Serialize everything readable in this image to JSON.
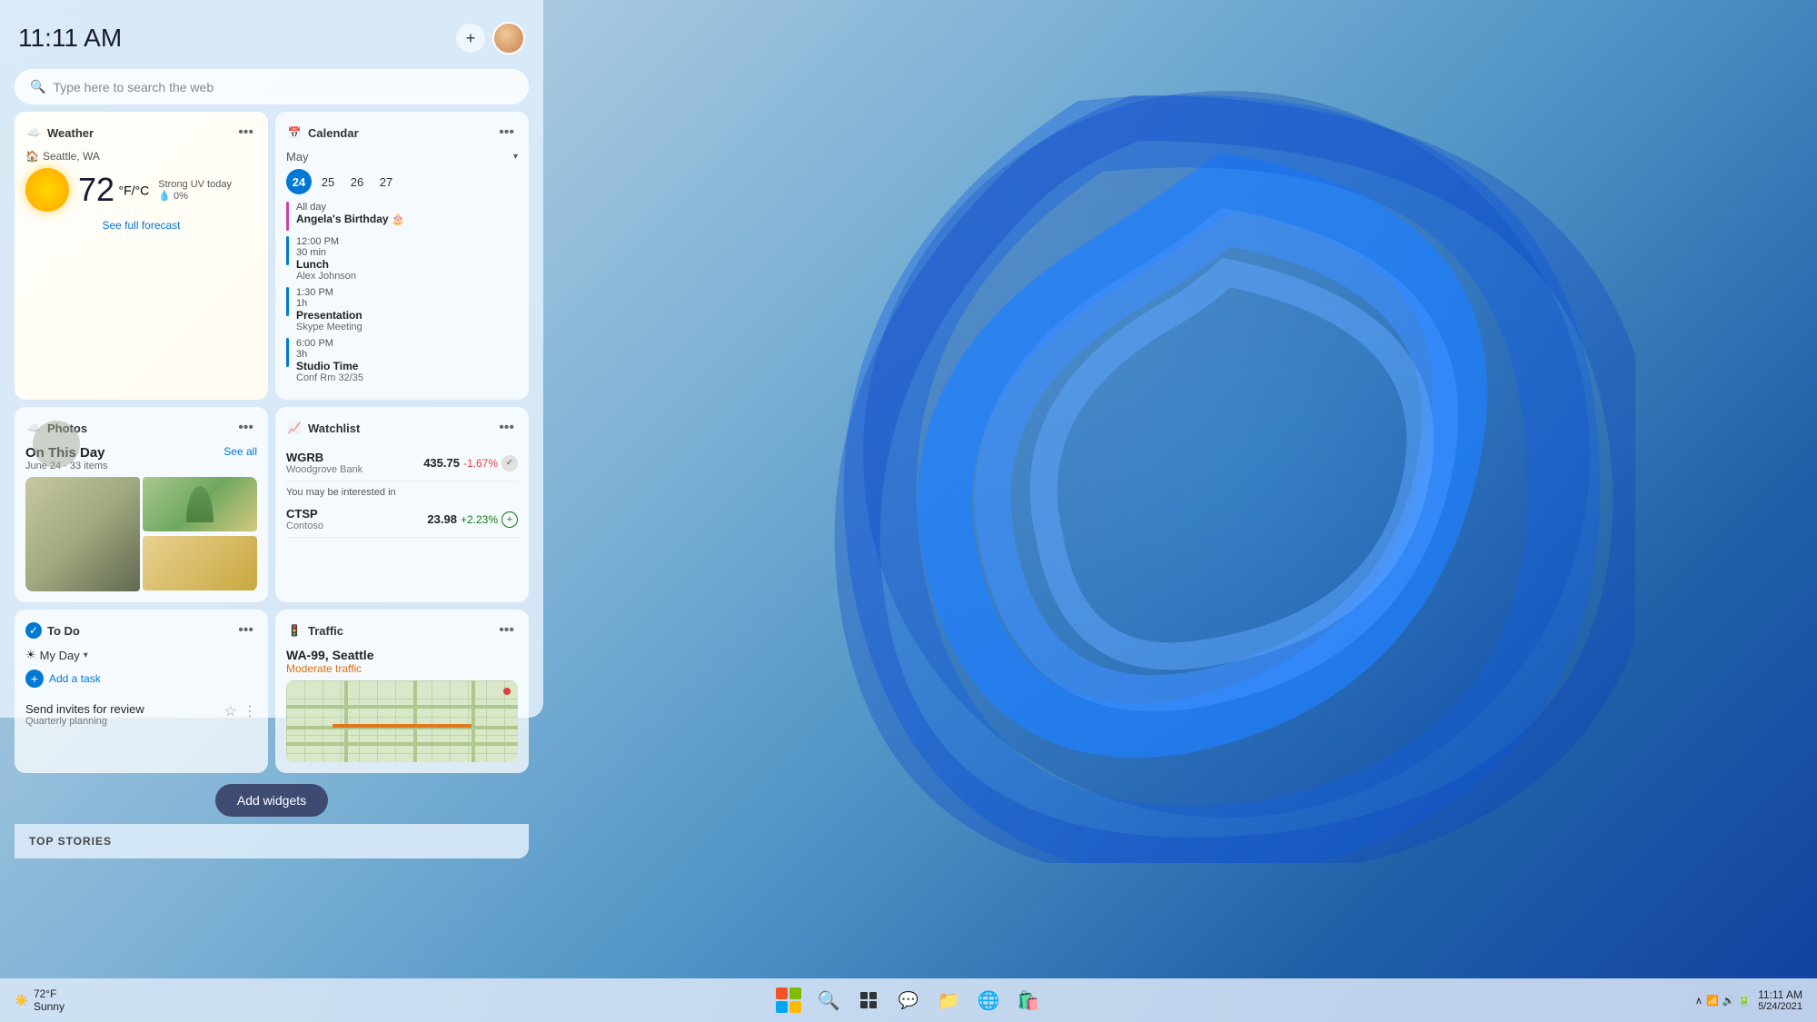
{
  "desktop": {
    "bg_description": "Windows 11 blue swirl wallpaper"
  },
  "panel": {
    "time": "11:11 AM",
    "add_button_label": "+",
    "search_placeholder": "Type here to search the web"
  },
  "weather": {
    "title": "Weather",
    "location": "Seattle, WA",
    "temp": "72",
    "unit": "°F",
    "unit_alt": "°C",
    "condition": "Strong UV today",
    "precip": "0%",
    "forecast_link": "See full forecast"
  },
  "calendar": {
    "title": "Calendar",
    "month": "May",
    "days": [
      "24",
      "25",
      "26",
      "27"
    ],
    "active_day": "24",
    "events": [
      {
        "type": "allday",
        "time": "All day",
        "name": "Angela's Birthday 🎂",
        "sub": ""
      },
      {
        "type": "lunch",
        "time": "12:00 PM",
        "duration": "30 min",
        "name": "Lunch",
        "sub": "Alex Johnson"
      },
      {
        "type": "presentation",
        "time": "1:30 PM",
        "duration": "1h",
        "name": "Presentation",
        "sub": "Skype Meeting"
      },
      {
        "type": "studio",
        "time": "6:00 PM",
        "duration": "3h",
        "name": "Studio Time",
        "sub": "Conf Rm 32/35"
      }
    ]
  },
  "photos": {
    "title": "Photos",
    "on_this_day_label": "On This Day",
    "date": "June 24 · 33 items",
    "see_all": "See all"
  },
  "watchlist": {
    "title": "Watchlist",
    "stocks": [
      {
        "symbol": "WGRB",
        "company": "Woodgrove Bank",
        "price": "435.75",
        "change": "-1.67%",
        "positive": false
      },
      {
        "symbol": "CTSP",
        "company": "Contoso",
        "price": "23.98",
        "change": "+2.23%",
        "positive": true
      }
    ],
    "interested_label": "You may be interested in"
  },
  "todo": {
    "title": "To Do",
    "my_day_label": "My Day",
    "add_task_label": "Add a task",
    "tasks": [
      {
        "name": "Send invites for review",
        "sub": "Quarterly planning",
        "starred": false
      }
    ]
  },
  "traffic": {
    "title": "Traffic",
    "road": "WA-99, Seattle",
    "status": "Moderate traffic"
  },
  "add_widgets_btn": "Add widgets",
  "top_stories": "TOP STORIES",
  "taskbar": {
    "temp": "72°F",
    "condition": "Sunny",
    "time": "11:11 AM",
    "date": "5/24/2021",
    "icons": [
      "⊞",
      "🔍",
      "📁",
      "💬",
      "📁",
      "🌐",
      "🛒"
    ]
  }
}
